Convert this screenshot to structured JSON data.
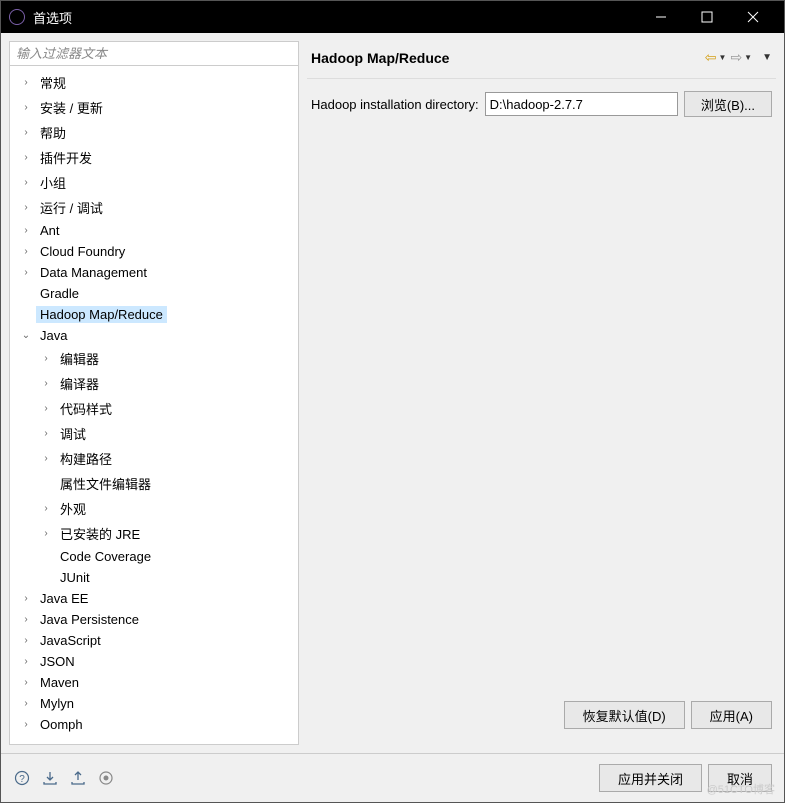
{
  "window": {
    "title": "首选项"
  },
  "sidebar": {
    "filter_placeholder": "输入过滤器文本",
    "items": [
      {
        "label": "常规",
        "expandable": true,
        "expanded": false,
        "level": 0
      },
      {
        "label": "安装 / 更新",
        "expandable": true,
        "expanded": false,
        "level": 0
      },
      {
        "label": "帮助",
        "expandable": true,
        "expanded": false,
        "level": 0
      },
      {
        "label": "插件开发",
        "expandable": true,
        "expanded": false,
        "level": 0
      },
      {
        "label": "小组",
        "expandable": true,
        "expanded": false,
        "level": 0
      },
      {
        "label": "运行 / 调试",
        "expandable": true,
        "expanded": false,
        "level": 0
      },
      {
        "label": "Ant",
        "expandable": true,
        "expanded": false,
        "level": 0
      },
      {
        "label": "Cloud Foundry",
        "expandable": true,
        "expanded": false,
        "level": 0
      },
      {
        "label": "Data Management",
        "expandable": true,
        "expanded": false,
        "level": 0
      },
      {
        "label": "Gradle",
        "expandable": false,
        "expanded": false,
        "level": 0
      },
      {
        "label": "Hadoop Map/Reduce",
        "expandable": false,
        "expanded": false,
        "level": 0,
        "selected": true
      },
      {
        "label": "Java",
        "expandable": true,
        "expanded": true,
        "level": 0
      },
      {
        "label": "编辑器",
        "expandable": true,
        "expanded": false,
        "level": 1
      },
      {
        "label": "编译器",
        "expandable": true,
        "expanded": false,
        "level": 1
      },
      {
        "label": "代码样式",
        "expandable": true,
        "expanded": false,
        "level": 1
      },
      {
        "label": "调试",
        "expandable": true,
        "expanded": false,
        "level": 1
      },
      {
        "label": "构建路径",
        "expandable": true,
        "expanded": false,
        "level": 1
      },
      {
        "label": "属性文件编辑器",
        "expandable": false,
        "expanded": false,
        "level": 1
      },
      {
        "label": "外观",
        "expandable": true,
        "expanded": false,
        "level": 1
      },
      {
        "label": "已安装的 JRE",
        "expandable": true,
        "expanded": false,
        "level": 1
      },
      {
        "label": "Code Coverage",
        "expandable": false,
        "expanded": false,
        "level": 1
      },
      {
        "label": "JUnit",
        "expandable": false,
        "expanded": false,
        "level": 1
      },
      {
        "label": "Java EE",
        "expandable": true,
        "expanded": false,
        "level": 0
      },
      {
        "label": "Java Persistence",
        "expandable": true,
        "expanded": false,
        "level": 0
      },
      {
        "label": "JavaScript",
        "expandable": true,
        "expanded": false,
        "level": 0
      },
      {
        "label": "JSON",
        "expandable": true,
        "expanded": false,
        "level": 0
      },
      {
        "label": "Maven",
        "expandable": true,
        "expanded": false,
        "level": 0
      },
      {
        "label": "Mylyn",
        "expandable": true,
        "expanded": false,
        "level": 0
      },
      {
        "label": "Oomph",
        "expandable": true,
        "expanded": false,
        "level": 0
      }
    ]
  },
  "main": {
    "title": "Hadoop Map/Reduce",
    "form": {
      "dir_label": "Hadoop installation directory:",
      "dir_value": "D:\\hadoop-2.7.7",
      "browse_label": "浏览(B)..."
    },
    "restore_defaults": "恢复默认值(D)",
    "apply": "应用(A)"
  },
  "footer": {
    "apply_close": "应用并关闭",
    "cancel": "取消"
  },
  "watermark": "@51CTO博客"
}
